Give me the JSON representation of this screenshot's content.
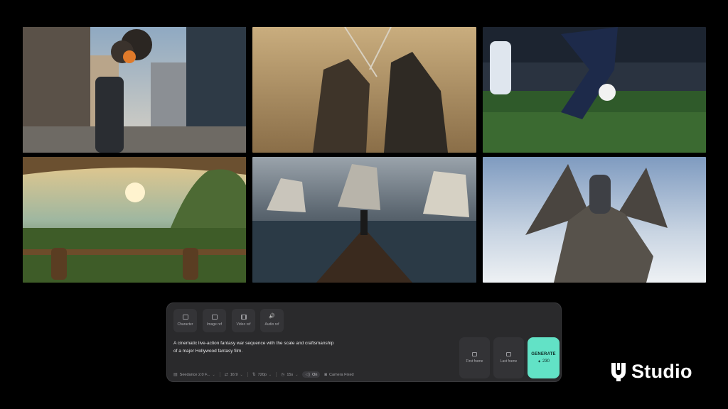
{
  "gallery": {
    "tiles": [
      {
        "name": "city-explosion-scene"
      },
      {
        "name": "knights-sword-fight-scene"
      },
      {
        "name": "football-match-scene"
      },
      {
        "name": "fantasy-forest-flight-scene"
      },
      {
        "name": "pirate-ship-battle-scene"
      },
      {
        "name": "dragon-rider-scene"
      }
    ]
  },
  "composer": {
    "refs": [
      {
        "label": "Character",
        "icon": "image-icon"
      },
      {
        "label": "Image ref",
        "icon": "image-icon"
      },
      {
        "label": "Video ref",
        "icon": "film-icon"
      },
      {
        "label": "Audio ref",
        "icon": "speaker-icon"
      }
    ],
    "prompt": "A cinematic live-action fantasy war sequence with the scale and craftsmanship of a major Hollywood fantasy film.",
    "options": {
      "model": "Seedance 2.0 F...",
      "aspect": "16:9",
      "resolution": "720p",
      "duration": "15s",
      "audio": "On",
      "camera": "Camera Fixed"
    },
    "first_frame_label": "First frame",
    "last_frame_label": "Last frame",
    "generate_label": "GENERATE",
    "generate_cost": "230",
    "accent_color": "#62e2c6"
  },
  "brand": {
    "name": "Studio",
    "logo_icon": "studio-logo-mark-icon"
  }
}
